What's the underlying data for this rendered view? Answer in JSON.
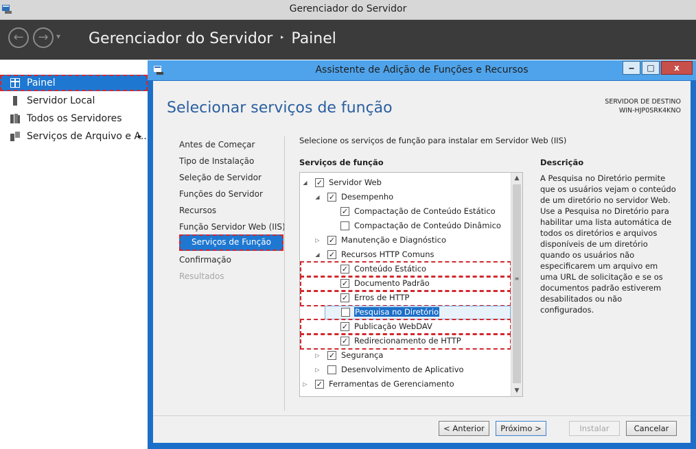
{
  "window": {
    "title": "Gerenciador do Servidor"
  },
  "header": {
    "app": "Gerenciador do Servidor",
    "separator": "‣",
    "page": "Painel",
    "back": "←",
    "forward": "→",
    "dropdown": "▾"
  },
  "sidebar": {
    "items": [
      {
        "label": "Painel",
        "icon": "dashboard-icon"
      },
      {
        "label": "Servidor Local",
        "icon": "server-icon"
      },
      {
        "label": "Todos os Servidores",
        "icon": "servers-icon"
      },
      {
        "label": "Serviços de Arquivo e A...",
        "icon": "file-services-icon"
      }
    ],
    "expand_arrow": "▸"
  },
  "dialog": {
    "title": "Assistente de Adição de Funções e Recursos",
    "minimize": "‒",
    "maximize": "□",
    "close": "x",
    "heading": "Selecionar serviços de função",
    "destination_label": "SERVIDOR DE DESTINO",
    "destination_value": "WIN-HJP0SRK4KNO",
    "steps": [
      "Antes de Começar",
      "Tipo de Instalação",
      "Seleção de Servidor",
      "Funções do Servidor",
      "Recursos",
      "Função Servidor Web (IIS)",
      "Serviços de Função",
      "Confirmação",
      "Resultados"
    ],
    "instruction": "Selecione os serviços de função para instalar em Servidor Web (IIS)",
    "services_header": "Serviços de função",
    "description_header": "Descrição",
    "description": "A Pesquisa no Diretório permite que os usuários vejam o conteúdo de um diretório no servidor Web. Use a Pesquisa no Diretório para habilitar uma lista automática de todos os diretórios e arquivos disponíveis de um diretório quando os usuários não especificarem um arquivo em uma URL de solicitação e se os documentos padrão estiverem desabilitados ou não configurados.",
    "tree": [
      {
        "label": "Servidor Web",
        "checked": true,
        "expander": "◢"
      },
      {
        "label": "Desempenho",
        "checked": true,
        "expander": "◢"
      },
      {
        "label": "Compactação de Conteúdo Estático",
        "checked": true,
        "expander": ""
      },
      {
        "label": "Compactação de Conteúdo Dinâmico",
        "checked": false,
        "expander": ""
      },
      {
        "label": "Manutenção e Diagnóstico",
        "checked": true,
        "expander": "▷"
      },
      {
        "label": "Recursos HTTP Comuns",
        "checked": true,
        "expander": "◢"
      },
      {
        "label": "Conteúdo Estático",
        "checked": true,
        "expander": ""
      },
      {
        "label": "Documento Padrão",
        "checked": true,
        "expander": ""
      },
      {
        "label": "Erros de HTTP",
        "checked": true,
        "expander": ""
      },
      {
        "label": "Pesquisa no Diretório",
        "checked": false,
        "expander": ""
      },
      {
        "label": "Publicação WebDAV",
        "checked": true,
        "expander": ""
      },
      {
        "label": "Redirecionamento de HTTP",
        "checked": true,
        "expander": ""
      },
      {
        "label": "Segurança",
        "checked": true,
        "expander": "▷"
      },
      {
        "label": "Desenvolvimento de Aplicativo",
        "checked": false,
        "expander": "▷"
      },
      {
        "label": "Ferramentas de Gerenciamento",
        "checked": true,
        "expander": "▷"
      }
    ],
    "check_mark": "✓",
    "scroll": {
      "up": "▲",
      "down": "▼",
      "grip": "≡"
    },
    "buttons": {
      "previous": "< Anterior",
      "next": "Próximo >",
      "install": "Instalar",
      "cancel": "Cancelar"
    }
  }
}
